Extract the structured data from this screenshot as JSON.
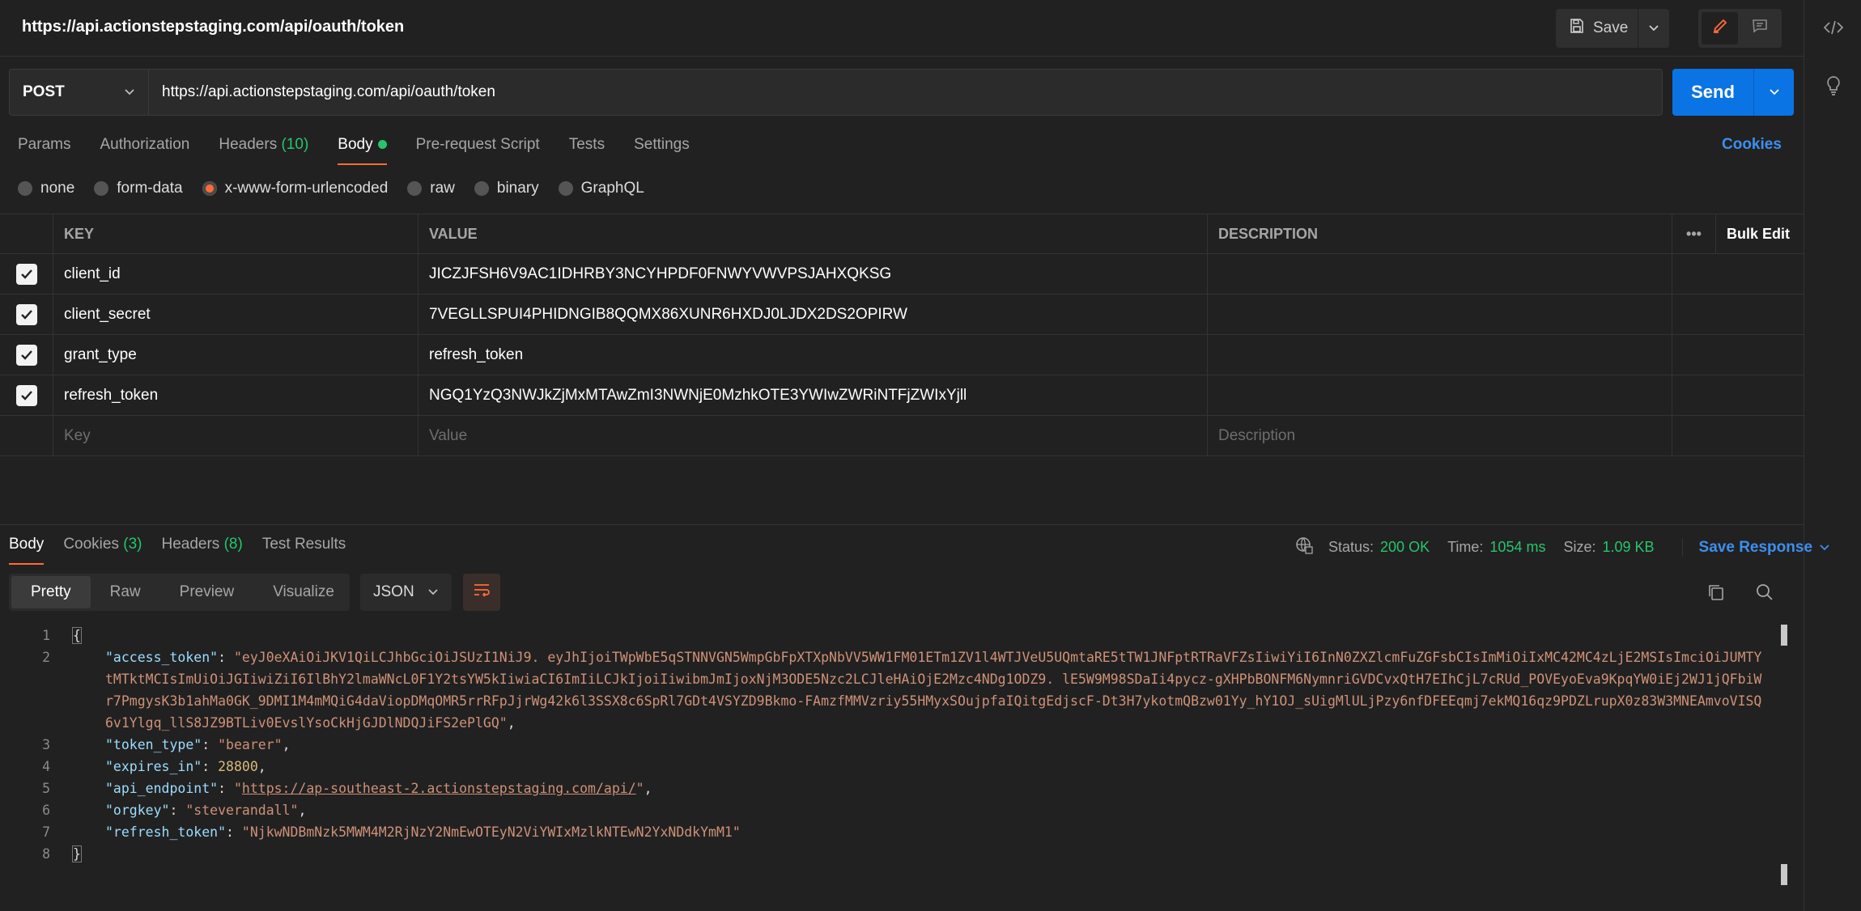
{
  "request": {
    "title": "https://api.actionstepstaging.com/api/oauth/token",
    "save_label": "Save",
    "method": "POST",
    "url": "https://api.actionstepstaging.com/api/oauth/token",
    "send_label": "Send",
    "tabs": [
      {
        "label": "Params"
      },
      {
        "label": "Authorization"
      },
      {
        "label": "Headers",
        "count": "(10)"
      },
      {
        "label": "Body"
      },
      {
        "label": "Pre-request Script"
      },
      {
        "label": "Tests"
      },
      {
        "label": "Settings"
      }
    ],
    "cookies_label": "Cookies",
    "body_types": [
      "none",
      "form-data",
      "x-www-form-urlencoded",
      "raw",
      "binary",
      "GraphQL"
    ],
    "selected_body_type": "x-www-form-urlencoded"
  },
  "params_table": {
    "headers": {
      "key": "KEY",
      "value": "VALUE",
      "description": "DESCRIPTION",
      "more": "•••",
      "bulk_edit": "Bulk Edit"
    },
    "rows": [
      {
        "key": "client_id",
        "value": "JICZJFSH6V9AC1IDHRBY3NCYHPDF0FNWYVWVPSJAHXQKSG",
        "checked": true
      },
      {
        "key": "client_secret",
        "value": "7VEGLLSPUI4PHIDNGIB8QQMX86XUNR6HXDJ0LJDX2DS2OPIRW",
        "checked": true
      },
      {
        "key": "grant_type",
        "value": "refresh_token",
        "checked": true
      },
      {
        "key": "refresh_token",
        "value": "NGQ1YzQ3NWJkZjMxMTAwZmI3NWNjE0MzhkOTE3YWIwZWRiNTFjZWIxYjll",
        "checked": true
      }
    ],
    "placeholders": {
      "key": "Key",
      "value": "Value",
      "description": "Description"
    }
  },
  "response": {
    "tabs": [
      {
        "label": "Body"
      },
      {
        "label": "Cookies",
        "count": "(3)"
      },
      {
        "label": "Headers",
        "count": "(8)"
      },
      {
        "label": "Test Results"
      }
    ],
    "status_label": "Status:",
    "status_value": "200 OK",
    "time_label": "Time:",
    "time_value": "1054 ms",
    "size_label": "Size:",
    "size_value": "1.09 KB",
    "save_response_label": "Save Response",
    "view_modes": [
      "Pretty",
      "Raw",
      "Preview",
      "Visualize"
    ],
    "format": "JSON",
    "json": {
      "open": "{",
      "close": "}",
      "access_token_key": "\"access_token\"",
      "access_token_value": "\"eyJ0eXAiOiJKV1QiLCJhbGciOiJSUzI1NiJ9. eyJhIjoiTWpWbE5qSTNNVGN5WmpGbFpXTXpNbVV5WW1FM01ETm1ZV1l4WTJVeU5UQmtaRE5tTW1JNFptRTRaVFZsIiwiYiI6InN0ZXZlcmFuZGFsbCIsImMiOiIxMC42MC4zLjE2MSIsImciOiJUMTYtMTktMCIsImUiOiJGIiwiZiI6IlBhY2lmaWNcL0F1Y2tsYW5kIiwiaCI6ImIiLCJkIjoiIiwibmJmIjoxNjM3ODE5Nzc2LCJleHAiOjE2Mzc4NDg1ODZ9. lE5W9M98SDaIi4pycz-gXHPbBONFM6NymnriGVDCvxQtH7EIhCjL7cRUd_POVEyoEva9KpqYW0iEj2WJ1jQFbiWr7PmgysK3b1ahMa0GK_9DMI1M4mMQiG4daViopDMqOMR5rrRFpJjrWg42k6l3SSX8c6SpRl7GDt4VSYZD9Bkmo-FAmzfMMVzriy55HMyxSOujpfaIQitgEdjscF-Dt3H7ykotmQBzw01Yy_hY1OJ_sUigMlULjPzy6nfDFEEqmj7ekMQ16qz9PDZLrupX0z83W3MNEAmvoVISQ6v1Ylgq_llS8JZ9BTLiv0EvslYsoCkHjGJDlNDQJiFS2ePlGQ\"",
      "token_type_key": "\"token_type\"",
      "token_type_value": "\"bearer\"",
      "expires_in_key": "\"expires_in\"",
      "expires_in_value": "28800",
      "api_endpoint_key": "\"api_endpoint\"",
      "api_endpoint_value": "https://ap-southeast-2.actionstepstaging.com/api/",
      "orgkey_key": "\"orgkey\"",
      "orgkey_value": "\"steverandall\"",
      "refresh_token_key": "\"refresh_token\"",
      "refresh_token_value": "\"NjkwNDBmNzk5MWM4M2RjNzY2NmEwOTEyN2ViYWIxMzlkNTEwN2YxNDdkYmM1\""
    },
    "line_numbers": [
      "1",
      "2",
      "3",
      "4",
      "5",
      "6",
      "7",
      "8"
    ]
  },
  "colors": {
    "accent": "#ff6c37",
    "primary": "#0b74e5",
    "success": "#27c56b",
    "link": "#3d8fef"
  },
  "icons": [
    "save-icon",
    "chevron-down-icon",
    "pencil-icon",
    "comment-icon",
    "code-icon",
    "lightbulb-icon",
    "globe-icon",
    "wrap-lines-icon",
    "copy-icon",
    "search-icon",
    "check-icon"
  ]
}
